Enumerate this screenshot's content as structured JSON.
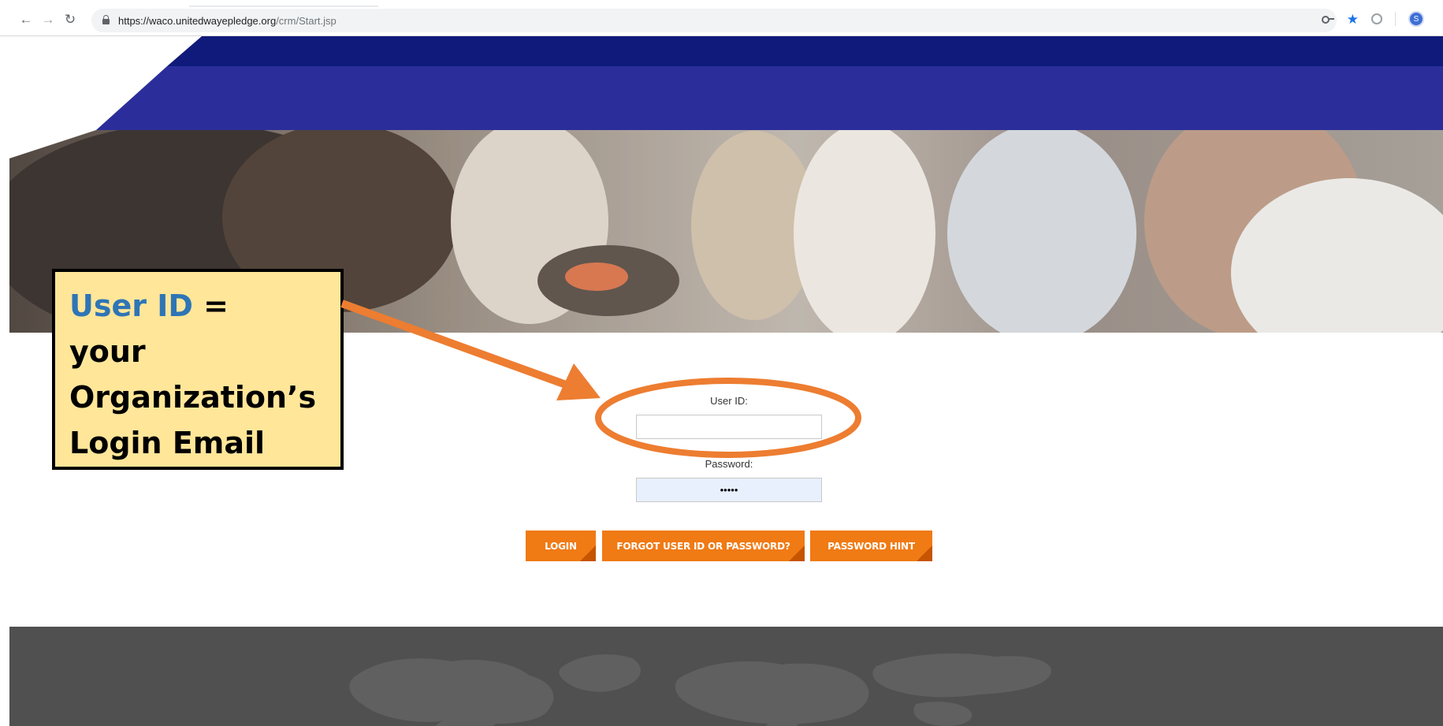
{
  "browser": {
    "url_domain": "https://waco.unitedwayepledge.org",
    "url_path": "/crm/Start.jsp",
    "back_icon": "arrow-left-icon",
    "forward_icon": "arrow-right-icon",
    "reload_icon": "reload-icon",
    "profile_initial": "S"
  },
  "login": {
    "user_id_label": "User ID:",
    "user_id_value": "",
    "password_label": "Password:",
    "password_value": "•••••"
  },
  "buttons": {
    "login": "LOGIN",
    "forgot": "FORGOT USER ID OR PASSWORD?",
    "hint": "PASSWORD HINT"
  },
  "callout": {
    "highlight": "User ID",
    "equals": " =",
    "line2": "your",
    "line3": "Organization’s",
    "line4": "Login Email"
  },
  "colors": {
    "accent_orange": "#f07a14",
    "navy": "#0f1a7a",
    "royal_blue": "#2b2e9a",
    "callout_fill": "#ffe699",
    "callout_highlight": "#2e75b6",
    "footer_gray": "#505050"
  }
}
